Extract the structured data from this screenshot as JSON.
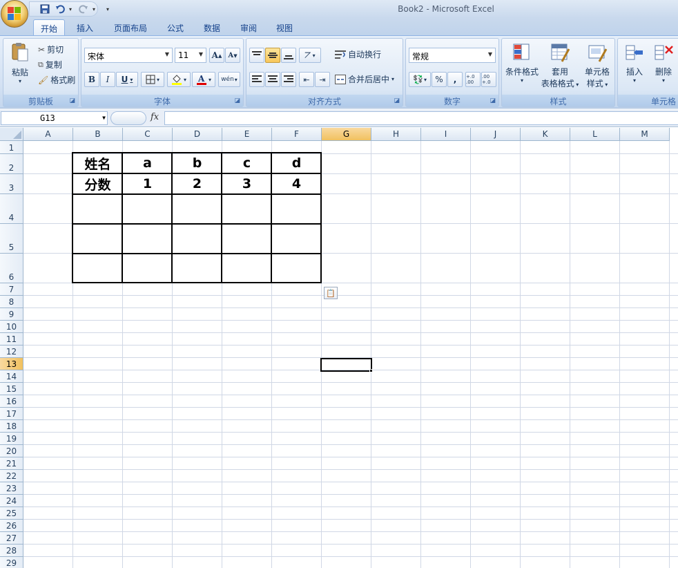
{
  "window": {
    "title": "Book2 - Microsoft Excel"
  },
  "qat": {
    "customize_label": "▾"
  },
  "tabs": [
    {
      "label": "开始",
      "active": true
    },
    {
      "label": "插入"
    },
    {
      "label": "页面布局"
    },
    {
      "label": "公式"
    },
    {
      "label": "数据"
    },
    {
      "label": "审阅"
    },
    {
      "label": "视图"
    }
  ],
  "ribbon": {
    "clipboard": {
      "label": "剪贴板",
      "paste": "粘贴",
      "cut": "剪切",
      "copy": "复制",
      "format_painter": "格式刷"
    },
    "font": {
      "label": "字体",
      "font_name": "宋体",
      "font_size": "11",
      "bold": "B",
      "italic": "I",
      "underline": "U",
      "grow": "A",
      "shrink": "A",
      "phonetic": "wén"
    },
    "alignment": {
      "label": "对齐方式",
      "wrap": "自动换行",
      "merge": "合并后居中"
    },
    "number": {
      "label": "数字",
      "format": "常规",
      "percent": "%",
      "comma": ",",
      "inc_decimal": "+.0 .00",
      "dec_decimal": ".00 +.0"
    },
    "styles": {
      "label": "样式",
      "conditional": "条件格式",
      "table_line1": "套用",
      "table_line2": "表格格式",
      "cell_line1": "单元格",
      "cell_line2": "样式"
    },
    "cells": {
      "label": "单元格",
      "insert": "插入",
      "delete": "删除"
    }
  },
  "formula_bar": {
    "name_box": "G13",
    "fx": "fx",
    "value": ""
  },
  "columns": [
    "A",
    "B",
    "C",
    "D",
    "E",
    "F",
    "G",
    "H",
    "I",
    "J",
    "K",
    "L",
    "M"
  ],
  "rows": [
    "1",
    "2",
    "3",
    "4",
    "5",
    "6",
    "7",
    "8",
    "9",
    "10",
    "11",
    "12",
    "13",
    "14",
    "15",
    "16",
    "17",
    "18",
    "19",
    "20",
    "21",
    "22",
    "23",
    "24",
    "25",
    "26",
    "27",
    "28",
    "29"
  ],
  "selected": {
    "col": "G",
    "row": "13"
  },
  "sheet": {
    "header_row": [
      "姓名",
      "a",
      "b",
      "c",
      "d"
    ],
    "score_row": [
      "分数",
      "1",
      "2",
      "3",
      "4"
    ]
  },
  "colors": {
    "selected_header": "#f1c15f",
    "gridline": "#d0d7e5",
    "ribbon_text": "#15428b"
  }
}
